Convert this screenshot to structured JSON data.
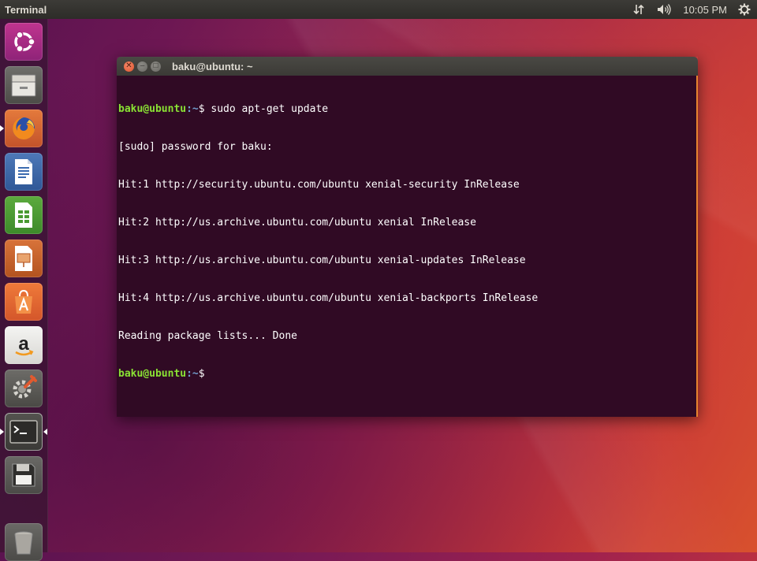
{
  "top_panel": {
    "app_title": "Terminal",
    "clock": "10:05 PM",
    "icons": [
      "network-arrows-icon",
      "volume-icon",
      "settings-gear-icon"
    ]
  },
  "launcher": {
    "items": [
      {
        "name": "ubuntu-dash",
        "icon": "ubuntu-logo-icon"
      },
      {
        "name": "files",
        "icon": "file-cabinet-icon"
      },
      {
        "name": "firefox",
        "icon": "firefox-icon"
      },
      {
        "name": "writer",
        "icon": "writer-document-icon"
      },
      {
        "name": "calc",
        "icon": "calc-spreadsheet-icon"
      },
      {
        "name": "impress",
        "icon": "impress-presentation-icon"
      },
      {
        "name": "software",
        "icon": "software-center-bag-icon"
      },
      {
        "name": "amazon",
        "icon": "amazon-icon"
      },
      {
        "name": "system-settings",
        "icon": "system-settings-icon"
      },
      {
        "name": "terminal",
        "icon": "terminal-icon"
      },
      {
        "name": "save",
        "icon": "floppy-disk-icon"
      },
      {
        "name": "trash",
        "icon": "trash-icon"
      }
    ]
  },
  "terminal": {
    "window_title": "baku@ubuntu: ~",
    "prompt_user": "baku@ubuntu",
    "prompt_path": ":~",
    "prompt_symbol": "$",
    "command": " sudo apt-get update",
    "output": [
      "[sudo] password for baku:",
      "Hit:1 http://security.ubuntu.com/ubuntu xenial-security InRelease",
      "Hit:2 http://us.archive.ubuntu.com/ubuntu xenial InRelease",
      "Hit:3 http://us.archive.ubuntu.com/ubuntu xenial-updates InRelease",
      "Hit:4 http://us.archive.ubuntu.com/ubuntu xenial-backports InRelease",
      "Reading package lists... Done"
    ],
    "colors": {
      "background": "#300a24",
      "prompt_user": "#8ae234",
      "prompt_path": "#729fcf",
      "text": "#ffffff",
      "accent_border": "#e6832f"
    }
  }
}
